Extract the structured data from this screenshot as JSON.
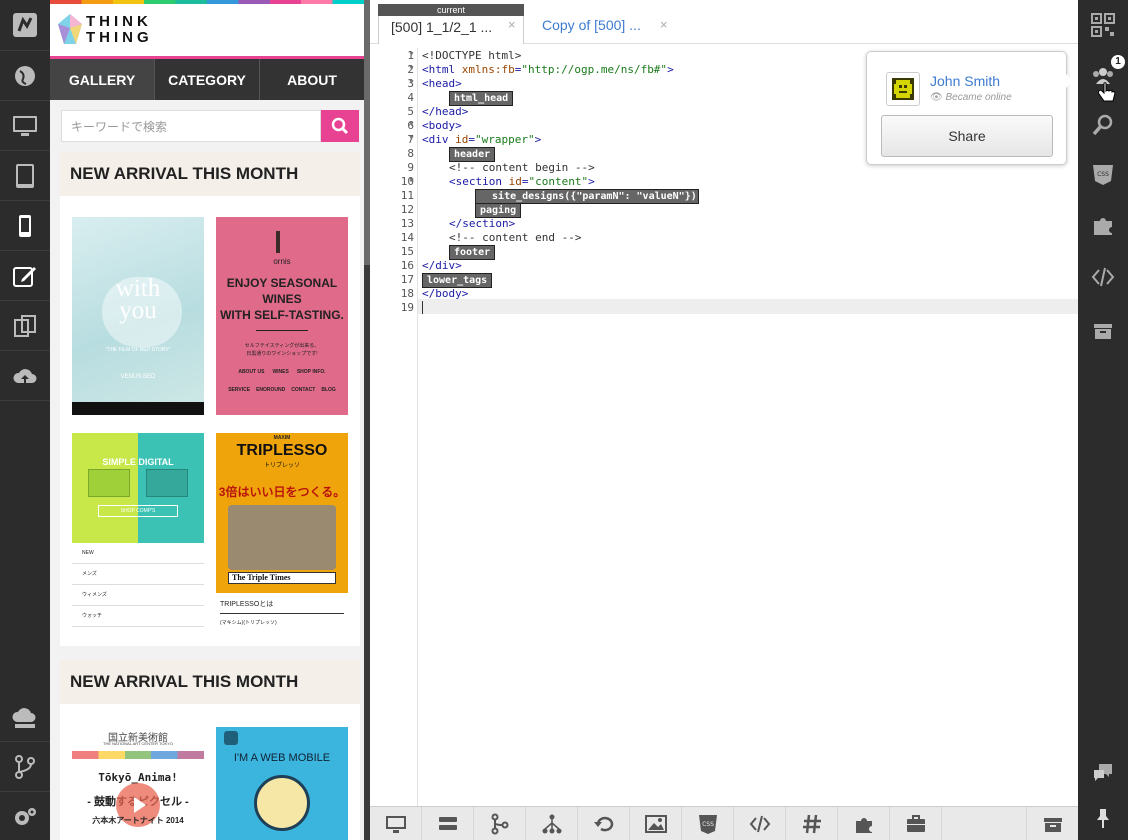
{
  "preview": {
    "logo_line1": "THINK",
    "logo_line2": "THING",
    "nav": [
      "GALLERY",
      "CATEGORY",
      "ABOUT"
    ],
    "search_placeholder": "キーワードで検索",
    "section1_title": "NEW ARRIVAL THIS MONTH",
    "section2_title": "NEW ARRIVAL THIS MONTH",
    "thumb1": {
      "line1": "with",
      "line2": "you",
      "caption": "\"THE FILM OF BED STORY\"",
      "brand": "VENUS BED"
    },
    "thumb2": {
      "brand": "ornis",
      "headline1": "ENJOY SEASONAL",
      "headline2": "WINES",
      "headline3": "WITH SELF-TASTING.",
      "sub": "セルフテイスティングが出来る、",
      "sub2": "日黒通りのワインショップです!",
      "links": [
        "ABOUT US",
        "WINES",
        "SHOP INFO."
      ],
      "links2": [
        "SERVICE",
        "ENOROUND",
        "CONTACT",
        "BLOG"
      ]
    },
    "thumb3": {
      "title": "SIMPLE DIGITAL",
      "btn": "SHOP COMP'S",
      "list": [
        "NEW",
        "メンズ",
        "ウィメンズ",
        "ウォッチ"
      ]
    },
    "thumb4": {
      "brand": "MAXIM",
      "title": "TRIPLESSO",
      "sub": "トリプレッソ",
      "tag": "3倍はいい日をつくる。",
      "paper": "The Triple Times",
      "item1": "TRIPLESSOとは",
      "item2": "(マキシム)(トリプレッソ)"
    },
    "thumb5": {
      "jp": "国立新美術館",
      "en": "THE NATIONAL ART CENTER TOKYO",
      "title": "Tōkyō_Anima!",
      "sub": "- 鼓動するピクセル -",
      "foot": "六本木アートナイト 2014"
    },
    "thumb6": {
      "title": "I'M A WEB MOBILE"
    }
  },
  "editor": {
    "current_label": "current",
    "tab1": "[500] 1_1/2_1 ...",
    "tab2": "Copy of [500] ...",
    "close": "×",
    "lines": [
      "1",
      "2",
      "3",
      "4",
      "5",
      "6",
      "7",
      "8",
      "9",
      "10",
      "11",
      "12",
      "13",
      "14",
      "15",
      "16",
      "17",
      "18",
      "19"
    ],
    "code": {
      "l1": "<!DOCTYPE html>",
      "l2a": "<html ",
      "l2b": "xmlns:fb",
      "l2c": "=",
      "l2d": "\"http://ogp.me/ns/fb#\"",
      "l2e": ">",
      "l3": "<head>",
      "l5": "</head>",
      "l6": "<body>",
      "l7a": "<div ",
      "l7b": "id",
      "l7c": "=",
      "l7d": "\"wrapper\"",
      "l7e": ">",
      "l9": "<!-- content begin -->",
      "l10a": "<section ",
      "l10b": "id",
      "l10c": "=",
      "l10d": "\"content\"",
      "l10e": ">",
      "l13": "</section>",
      "l14": "<!-- content end -->",
      "l16": "</div>",
      "l18": "</body>"
    },
    "tags": {
      "html_head": "html_head",
      "header": "header",
      "site_designs": "  site_designs({\"paramN\": \"valueN\"})",
      "paging": "paging",
      "footer": "footer",
      "lower_tags": "lower_tags"
    }
  },
  "popup": {
    "name": "John Smith",
    "status": "Became online",
    "share": "Share"
  },
  "right_sidebar": {
    "badge": "1",
    "css_label": "CSS"
  },
  "bottombar": {
    "css_label": "CSS"
  },
  "colors": {
    "accent_pink": "#e84393",
    "link_blue": "#3d7bd0",
    "dark": "#2c2c2c"
  }
}
